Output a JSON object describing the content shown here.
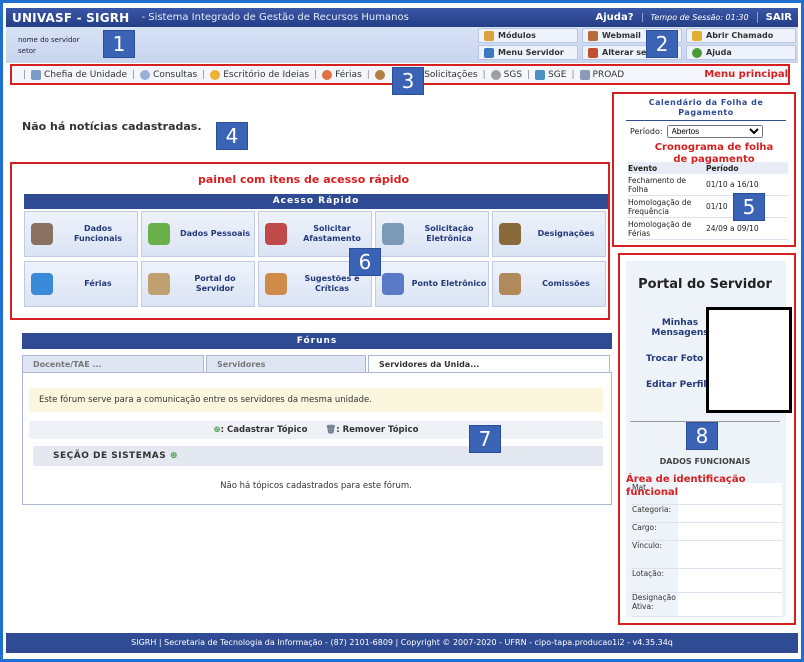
{
  "header": {
    "system": "UNIVASF - SIGRH",
    "system_name": "- Sistema Integrado de Gestão de Recursos Humanos",
    "help": "Ajuda?",
    "session": "Tempo de Sessão: 01:30",
    "logout": "SAIR"
  },
  "user": {
    "name": "nome do servidor",
    "sector": "setor"
  },
  "shortcuts": [
    {
      "label": "Módulos",
      "icon": "modules-icon"
    },
    {
      "label": "Webmail",
      "icon": "webmail-icon"
    },
    {
      "label": "Abrir Chamado",
      "icon": "ticket-icon"
    },
    {
      "label": "Menu Servidor",
      "icon": "menu-icon"
    },
    {
      "label": "Alterar se",
      "icon": "settings-icon"
    },
    {
      "label": "Ajuda",
      "icon": "help-icon"
    }
  ],
  "menu": {
    "items": [
      "Chefia de Unidade",
      "Consultas",
      "Escritório de Ideias",
      "Férias",
      "Solicitações",
      "SGS",
      "SGE",
      "PROAD"
    ],
    "label": "Menu principal"
  },
  "badges": [
    "1",
    "2",
    "3",
    "4",
    "5",
    "6",
    "7",
    "8"
  ],
  "news": "Não há notícias cadastradas.",
  "quick": {
    "label": "painel com itens de acesso rápido",
    "title": "Acesso Rápido",
    "items": [
      "Dados Funcionais",
      "Dados Pessoais",
      "Solicitar Afastamento",
      "Solicitação Eletrônica",
      "Designações",
      "Férias",
      "Portal do Servidor",
      "Sugestões e Críticas",
      "Ponto Eletrônico",
      "Comissões"
    ]
  },
  "forums": {
    "title": "Fóruns",
    "tabs": [
      "Docente/TAE ...",
      "Servidores",
      "Servidores da Unida..."
    ],
    "description": "Este fórum serve para a comunicação entre os servidores da mesma unidade.",
    "add_topic": ": Cadastrar Tópico",
    "remove_topic": ": Remover Tópico",
    "section": "SEÇÃO DE SISTEMAS",
    "empty": "Não há tópicos cadastrados para este fórum."
  },
  "payroll": {
    "title": "Calendário da Folha de Pagamento",
    "period_label": "Período:",
    "period_value": "Abertos",
    "annotation": "Cronograma de folha de pagamento",
    "col_event": "Evento",
    "col_period": "Período",
    "rows": [
      {
        "event": "Fechamento de Folha",
        "period": "01/10 a 16/10"
      },
      {
        "event": "Homologação de Frequência",
        "period": "01/10"
      },
      {
        "event": "Homologação de Férias",
        "period": "24/09 a 09/10"
      }
    ]
  },
  "portal": {
    "title": "Portal do Servidor",
    "links": [
      "Minhas Mensagens",
      "Trocar Foto",
      "Editar Perfil"
    ],
    "func_header": "DADOS FUNCIONAIS",
    "annotation": "Área de identificação funcional",
    "fields": [
      "Mat.",
      "Categoria:",
      "Cargo:",
      "Vínculo:",
      "Lotação:",
      "Designação Ativa:"
    ]
  },
  "footer": "SIGRH | Secretaria de Tecnologia da Informação - (87) 2101-6809 | Copyright © 2007-2020 - UFRN - cipo-tapa.producao1i2 - v4.35.34q"
}
